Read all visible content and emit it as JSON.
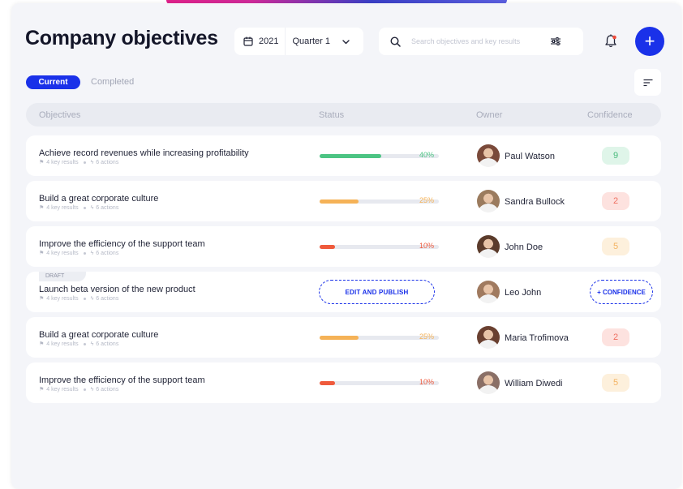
{
  "page": {
    "title": "Company objectives"
  },
  "period": {
    "year": "2021",
    "quarter": "Quarter 1"
  },
  "search": {
    "placeholder": "Search objectives and key results"
  },
  "actions": {
    "add_label": "+"
  },
  "tabs": [
    {
      "label": "Current",
      "active": true
    },
    {
      "label": "Completed",
      "active": false
    }
  ],
  "table": {
    "columns": [
      "Objectives",
      "Status",
      "Owner",
      "Confidence"
    ],
    "rows": [
      {
        "title": "Achieve record revenues while increasing profitability",
        "key_results": "4 key results",
        "actions": "6 actions",
        "progress": 40,
        "progress_label": "40%",
        "progress_color": "#4cc483",
        "owner": "Paul Watson",
        "confidence": "9",
        "confidence_bg": "#dff5e9",
        "confidence_color": "#46b97a",
        "avatar_color": "#7a4a3a"
      },
      {
        "title": "Build a great corporate culture",
        "key_results": "4 key results",
        "actions": "6 actions",
        "progress": 25,
        "progress_label": "25%",
        "progress_color": "#f5b257",
        "owner": "Sandra Bullock",
        "confidence": "2",
        "confidence_bg": "#fde2df",
        "confidence_color": "#ef7061",
        "avatar_color": "#9b7b5e"
      },
      {
        "title": "Improve the efficiency of the support team",
        "key_results": "4 key results",
        "actions": "6 actions",
        "progress": 10,
        "progress_label": "10%",
        "progress_color": "#ef5a3c",
        "owner": "John Doe",
        "confidence": "5",
        "confidence_bg": "#fdf0dc",
        "confidence_color": "#f3b260",
        "avatar_color": "#5b3b2b"
      },
      {
        "draft": true,
        "draft_label": "DRAFT",
        "title": "Launch beta version of the new product",
        "key_results": "4 key results",
        "actions": "6 actions",
        "edit_label": "EDIT AND PUBLISH",
        "owner": "Leo John",
        "confidence_label": "+ CONFIDENCE",
        "avatar_color": "#a07a5f"
      },
      {
        "title": "Build a great corporate culture",
        "key_results": "4 key results",
        "actions": "6 actions",
        "progress": 25,
        "progress_label": "25%",
        "progress_color": "#f5b257",
        "owner": "Maria Trofimova",
        "confidence": "2",
        "confidence_bg": "#fde2df",
        "confidence_color": "#ef7061",
        "avatar_color": "#6a4030"
      },
      {
        "title": "Improve the efficiency of the support team",
        "key_results": "4 key results",
        "actions": "6 actions",
        "progress": 10,
        "progress_label": "10%",
        "progress_color": "#ef5a3c",
        "owner": "William Diwedi",
        "confidence": "5",
        "confidence_bg": "#fdf0dc",
        "confidence_color": "#f3b260",
        "avatar_color": "#8a6f66"
      }
    ]
  }
}
